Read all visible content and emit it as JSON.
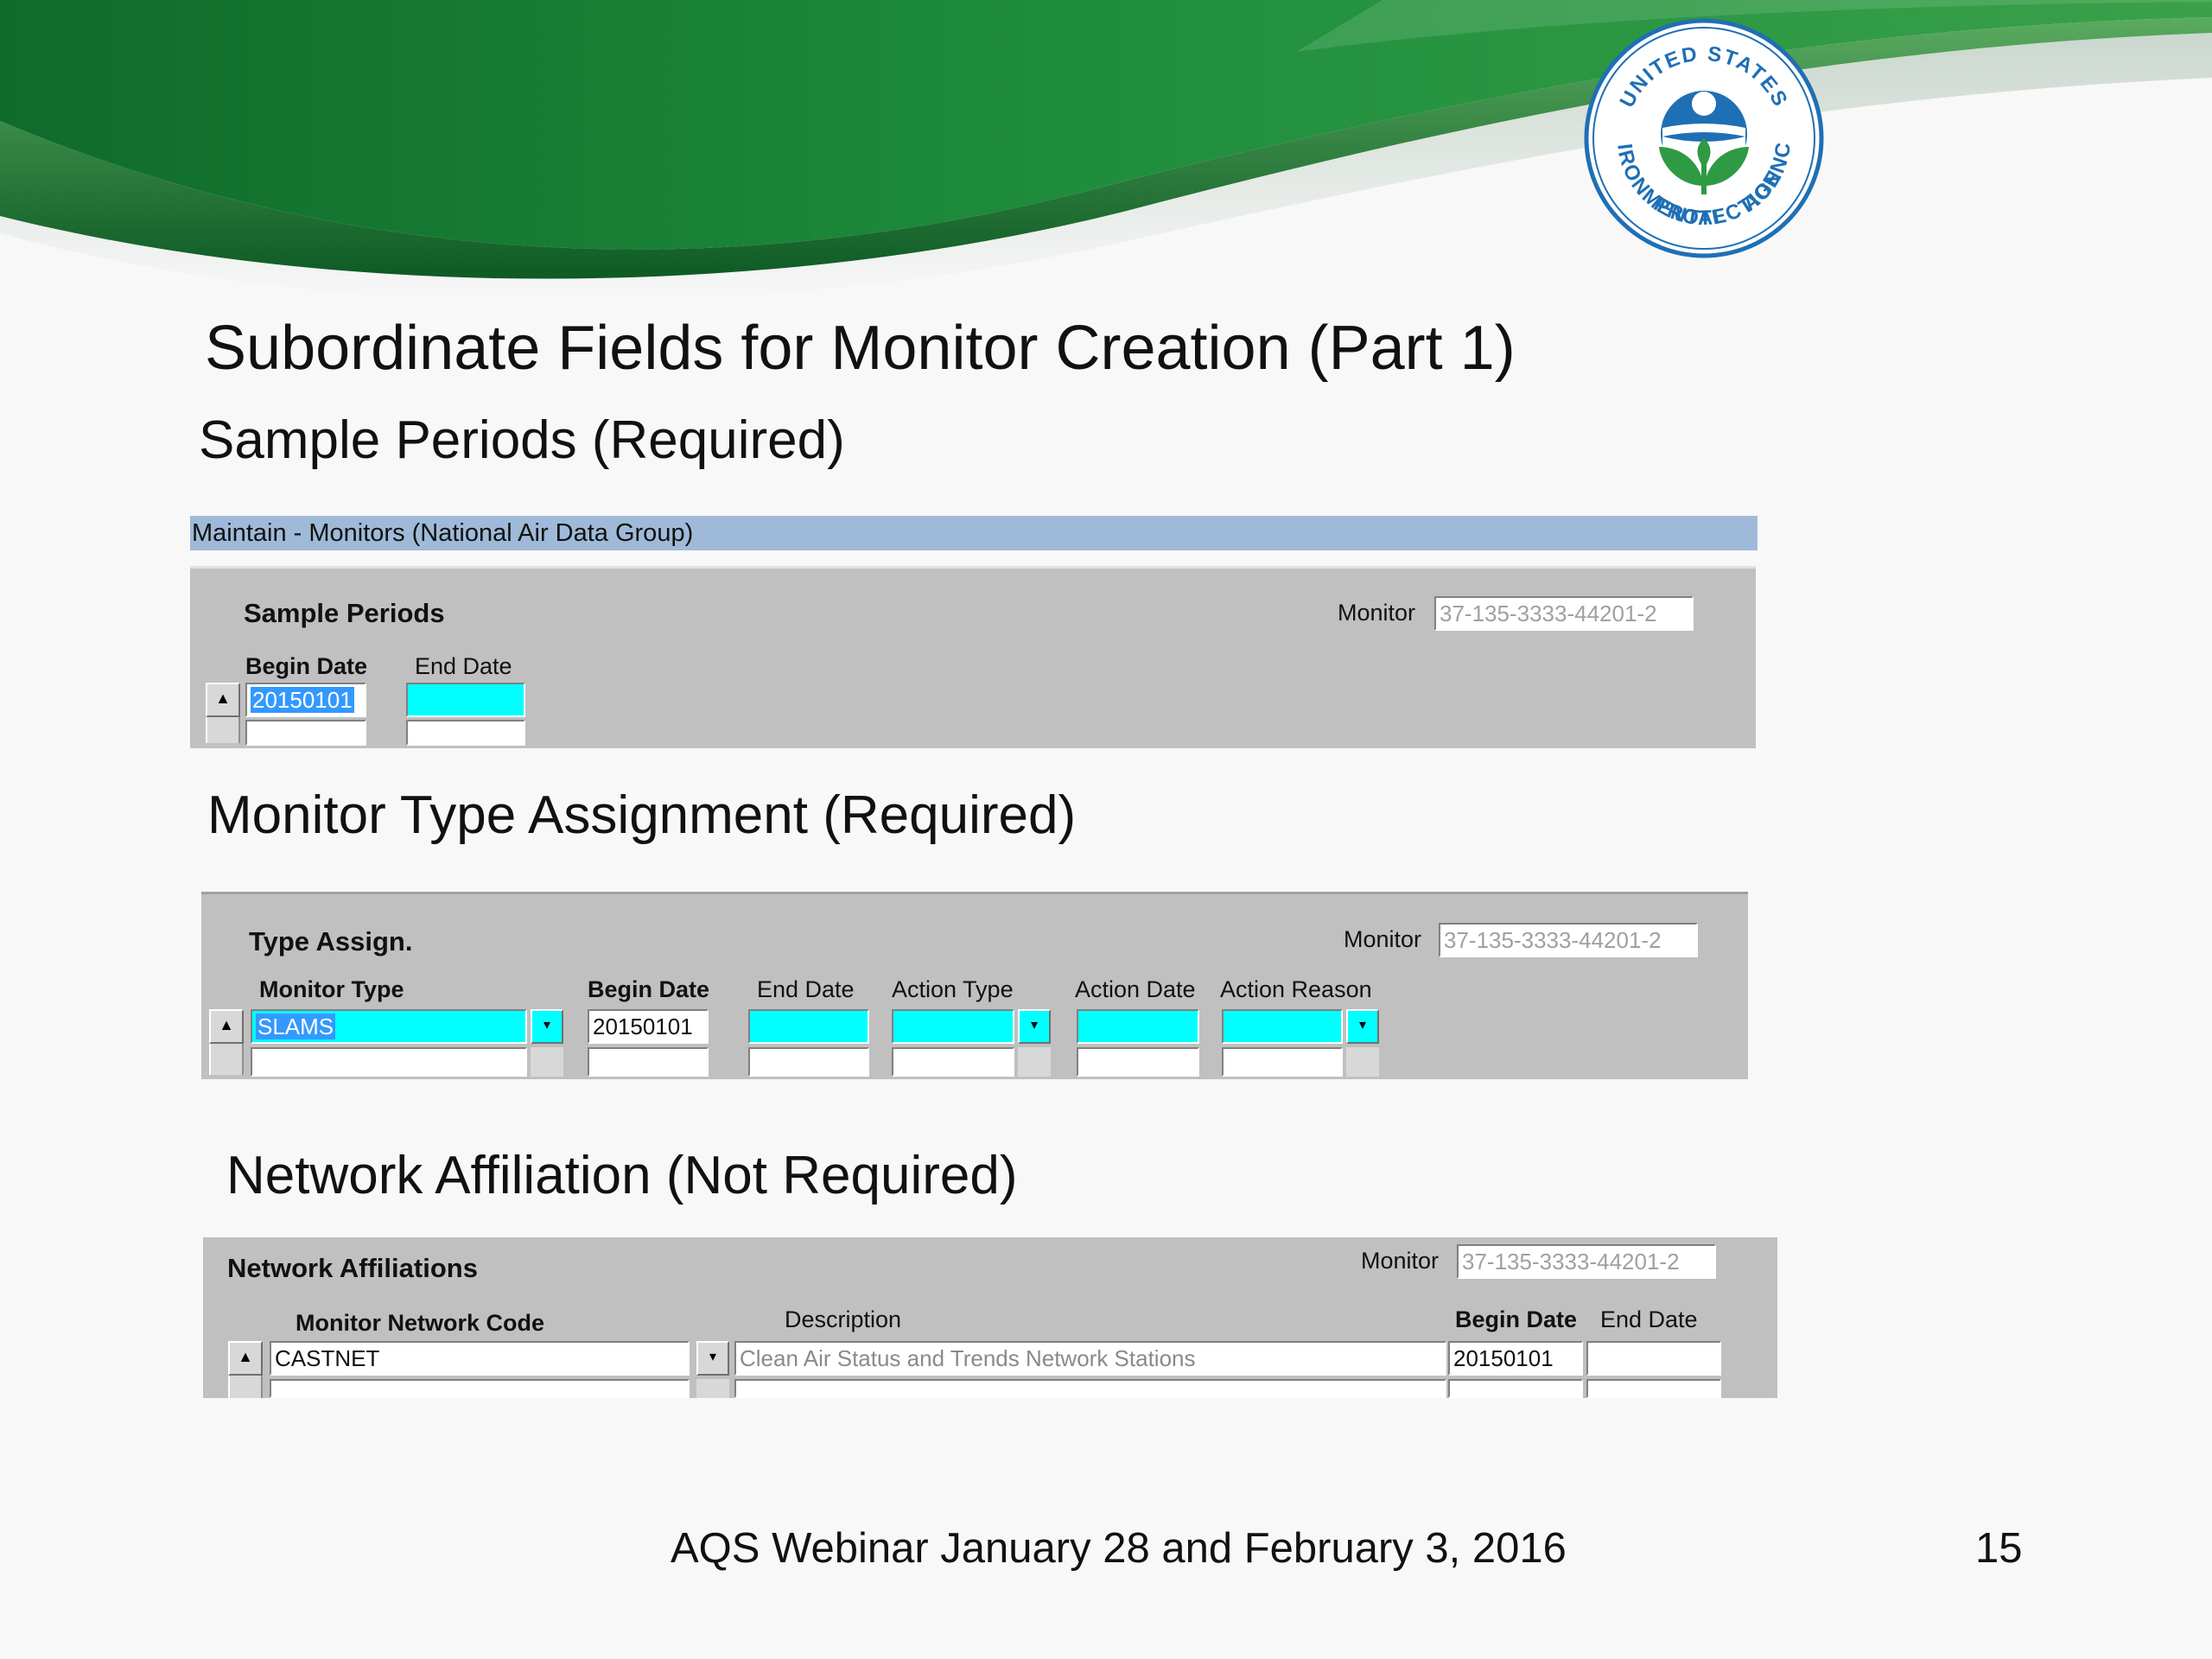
{
  "slide": {
    "title": "Subordinate Fields for Monitor Creation (Part 1)",
    "section1_heading": "Sample Periods (Required)",
    "section2_heading": "Monitor Type Assignment (Required)",
    "section3_heading": "Network Affiliation (Not Required)",
    "footer_text": "AQS Webinar January 28 and February 3, 2016",
    "page_number": "15"
  },
  "logo": {
    "top_text": "UNITED STATES",
    "left_text": "ENVIRONMENTAL",
    "bottom_text": "PROTECTION",
    "right_text": "AGENCY"
  },
  "sample_periods_form": {
    "window_title": "Maintain - Monitors (National Air Data Group)",
    "section_label": "Sample Periods",
    "monitor_label": "Monitor",
    "monitor_value": "37-135-3333-44201-2",
    "columns": [
      "Begin Date",
      "End Date"
    ],
    "row": {
      "begin_date": "20150101",
      "end_date": ""
    }
  },
  "type_assign_form": {
    "section_label": "Type Assign.",
    "monitor_label": "Monitor",
    "monitor_value": "37-135-3333-44201-2",
    "columns": [
      "Monitor Type",
      "Begin Date",
      "End Date",
      "Action Type",
      "Action Date",
      "Action Reason"
    ],
    "row": {
      "monitor_type": "SLAMS",
      "begin_date": "20150101",
      "end_date": "",
      "action_type": "",
      "action_date": "",
      "action_reason": ""
    }
  },
  "network_form": {
    "section_label": "Network Affiliations",
    "monitor_label": "Monitor",
    "monitor_value": "37-135-3333-44201-2",
    "columns": [
      "Monitor Network Code",
      "Description",
      "Begin Date",
      "End Date"
    ],
    "row": {
      "network_code": "CASTNET",
      "description": "Clean Air Status and Trends Network Stations",
      "begin_date": "20150101",
      "end_date": ""
    }
  },
  "colors": {
    "header_green": "#1e8a3a",
    "field_cyan": "#00ffff",
    "panel_grey": "#c0c0c0",
    "titlebar_blue": "#9fbad8",
    "selection_blue": "#3399ff"
  }
}
